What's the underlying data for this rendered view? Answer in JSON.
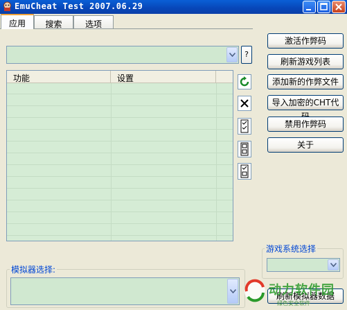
{
  "window": {
    "title": "EmuCheat Test 2007.06.29",
    "icon": "app-icon",
    "controls": [
      "minimize-icon",
      "maximize-icon",
      "close-icon"
    ]
  },
  "tabs": [
    {
      "label": "应用",
      "active": true
    },
    {
      "label": "搜索",
      "active": false
    },
    {
      "label": "选项",
      "active": false
    }
  ],
  "cheat_file_combo": {
    "value": "",
    "help_label": "?"
  },
  "cheat_list": {
    "columns": [
      "功能",
      "设置"
    ],
    "rows": []
  },
  "side_icons": [
    "refresh-icon",
    "delete-icon",
    "check-list-icon",
    "uncheck-list-icon",
    "toggle-list-icon"
  ],
  "buttons": {
    "activate": "激活作弊码",
    "refresh_games": "刷新游戏列表",
    "add_cheat_file": "添加新的作弊文件",
    "import_cht": "导入加密的CHT代码",
    "disable_cheats": "禁用作弊码",
    "about": "关于",
    "refresh_emu": "刷新模拟器数据"
  },
  "game_system": {
    "label": "游戏系统选择",
    "value": ""
  },
  "emulator": {
    "label": "模拟器选择:",
    "value": ""
  },
  "watermark": {
    "text": "动力软件园",
    "sub": "绿色安全软件"
  },
  "colors": {
    "title_bar": "#0a5fd6",
    "field_bg": "#d0e8d0",
    "tab_accent": "#f1a33b",
    "group_label": "#0046d5"
  }
}
